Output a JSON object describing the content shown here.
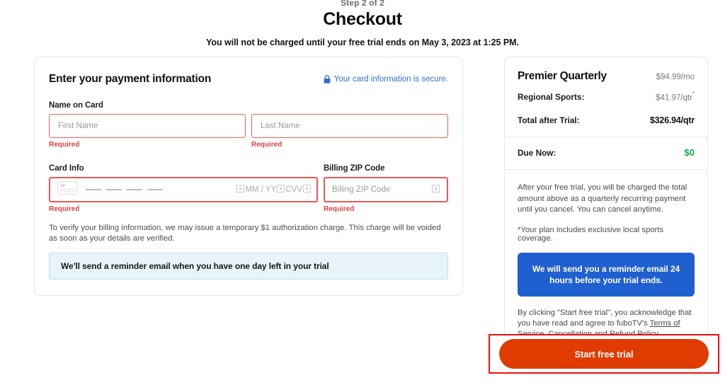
{
  "header": {
    "step": "Step 2 of 2",
    "title": "Checkout",
    "trial_note": "You will not be charged until your free trial ends on May 3, 2023 at 1:25 PM."
  },
  "payment": {
    "title": "Enter your payment information",
    "secure_text": "Your card information is secure.",
    "secure_icon": "lock-icon",
    "name_label": "Name on Card",
    "first_name_placeholder": "First Name",
    "first_name_value": "",
    "first_name_error": "Required",
    "last_name_placeholder": "Last Name",
    "last_name_value": "",
    "last_name_error": "Required",
    "card_label": "Card Info",
    "card_icon": "credit-card-icon",
    "card_expiry_placeholder": "MM / YY",
    "card_cvv_placeholder": "CVV",
    "card_error": "Required",
    "zip_label": "Billing ZIP Code",
    "zip_placeholder": "Billing ZIP Code",
    "zip_value": "",
    "zip_error": "Required",
    "verify_text": "To verify your billing information, we may issue a temporary $1 authorization charge. This charge will be voided as soon as your details are verified.",
    "reminder_banner": "We'll send a reminder email when you have one day left in your trial"
  },
  "summary": {
    "plan_name": "Premier Quarterly",
    "plan_price": "$94.99/mo",
    "regional_label": "Regional Sports:",
    "regional_price": "$41.97/qtr",
    "regional_asterisk": "*",
    "total_label": "Total after Trial:",
    "total_price": "$326.94/qtr",
    "due_label": "Due Now:",
    "due_value": "$0",
    "description": "After your free trial, you will be charged the total amount above as a quarterly recurring payment until you cancel. You can cancel anytime.",
    "footnote": "*Your plan includes exclusive local sports coverage.",
    "blue_box": "We will send you a reminder email 24 hours before your trial ends.",
    "terms_prefix": "By clicking \"Start free trial\", you acknowledge that you have read and agree to fuboTV's ",
    "terms_link": "Terms of Service",
    "terms_separator": ", ",
    "refund_link": "Cancellation and Refund Policy,"
  },
  "cta": {
    "label": "Start free trial"
  },
  "colors": {
    "accent_button": "#e03c02",
    "highlight_border": "#f50c0c",
    "error": "#d8453c",
    "link_blue": "#2f6fd0",
    "blue_box": "#1f5fd0",
    "due_green": "#18a544"
  }
}
